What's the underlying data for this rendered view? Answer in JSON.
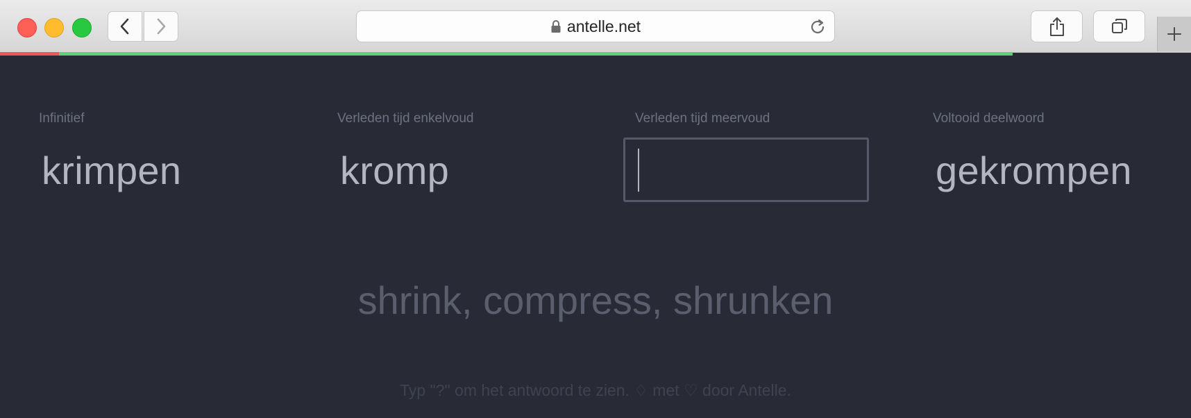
{
  "browser": {
    "url": "antelle.net",
    "progress_fraction": 0.85
  },
  "columns": [
    {
      "label": "Infinitief",
      "value": "krimpen"
    },
    {
      "label": "Verleden tijd enkelvoud",
      "value": "kromp"
    },
    {
      "label": "Verleden tijd meervoud",
      "value": "",
      "placeholder": ""
    },
    {
      "label": "Voltooid deelwoord",
      "value": "gekrompen"
    }
  ],
  "translation": "shrink, compress, shrunken",
  "footer": "Typ \"?\" om het antwoord te zien. ♢ met ♡ door Antelle.",
  "icons": {
    "back": "chevron-left-icon",
    "forward": "chevron-right-icon",
    "lock": "lock-icon",
    "reload": "reload-icon",
    "share": "share-icon",
    "tabs": "tabs-overview-icon",
    "new_tab": "plus-icon"
  },
  "colors": {
    "background": "#282b35",
    "progress_start": "#e85a5a",
    "progress_fill": "#5fd07a"
  }
}
